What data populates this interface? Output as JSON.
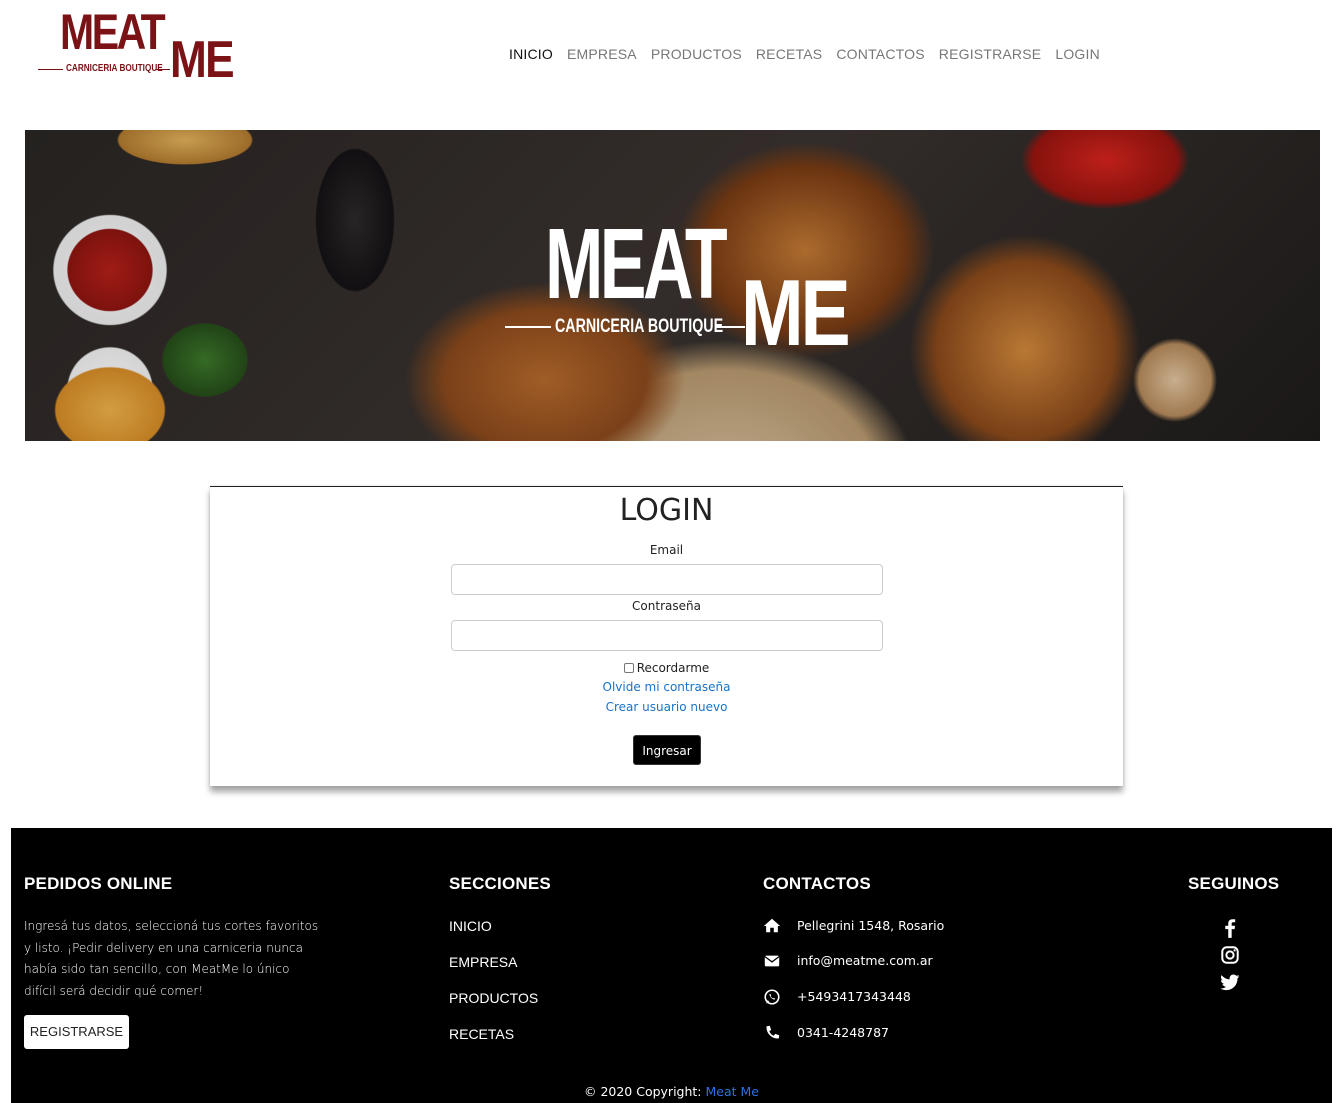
{
  "brand": {
    "logo_main": "MEAT",
    "logo_second": "ME",
    "logo_tagline": "CARNICERIA BOUTIQUE",
    "color": "#7a1216"
  },
  "nav": {
    "items": [
      {
        "label": "INICIO",
        "active": true
      },
      {
        "label": "EMPRESA"
      },
      {
        "label": "PRODUCTOS"
      },
      {
        "label": "RECETAS"
      },
      {
        "label": "CONTACTOS"
      },
      {
        "label": "REGISTRARSE"
      },
      {
        "label": "LOGIN"
      }
    ]
  },
  "banner": {
    "logo_main": "MEAT",
    "logo_second": "ME",
    "logo_tagline": "CARNICERIA BOUTIQUE"
  },
  "login": {
    "title": "LOGIN",
    "email_label": "Email",
    "email_value": "",
    "password_label": "Contraseña",
    "password_value": "",
    "remember_label": "Recordarme",
    "forgot_link": "Olvide mi contraseña",
    "new_user_link": "Crear usuario nuevo",
    "submit_label": "Ingresar"
  },
  "footer": {
    "online": {
      "title": "PEDIDOS ONLINE",
      "text": "Ingresá tus datos, seleccioná tus cortes favoritos y listo. ¡Pedir delivery en una carniceria nunca había sido tan sencillo, con MeatMe lo único difícil será decidir qué comer!",
      "button": "REGISTRARSE"
    },
    "sections": {
      "title": "SECCIONES",
      "links": [
        "INICIO",
        "EMPRESA",
        "PRODUCTOS",
        "RECETAS"
      ]
    },
    "contacts": {
      "title": "CONTACTOS",
      "items": [
        {
          "icon": "home-icon",
          "text": "Pellegrini 1548, Rosario"
        },
        {
          "icon": "envelope-icon",
          "text": "info@meatme.com.ar"
        },
        {
          "icon": "whatsapp-icon",
          "text": "+5493417343448"
        },
        {
          "icon": "phone-icon",
          "text": "0341-4248787"
        }
      ]
    },
    "social": {
      "title": "SEGUINOS",
      "icons": [
        "facebook-icon",
        "instagram-icon",
        "twitter-icon"
      ]
    },
    "copyright_prefix": "© 2020 Copyright:",
    "copyright_brand": "Meat Me",
    "brand_link_color": "#2f6fe0"
  }
}
